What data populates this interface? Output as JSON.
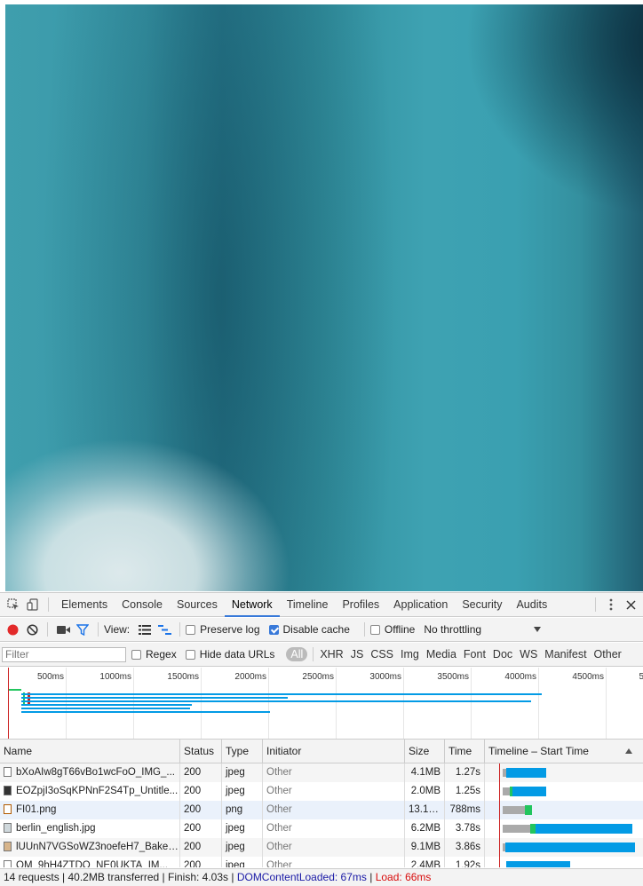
{
  "tabs": [
    "Elements",
    "Console",
    "Sources",
    "Network",
    "Timeline",
    "Profiles",
    "Application",
    "Security",
    "Audits"
  ],
  "active_tab": "Network",
  "toolbar": {
    "view_label": "View:",
    "preserve_log": "Preserve log",
    "disable_cache": "Disable cache",
    "offline": "Offline",
    "throttling": "No throttling",
    "record_color": "#e22929"
  },
  "filter": {
    "placeholder": "Filter",
    "regex": "Regex",
    "hide_data_urls": "Hide data URLs",
    "types": [
      "All",
      "XHR",
      "JS",
      "CSS",
      "Img",
      "Media",
      "Font",
      "Doc",
      "WS",
      "Manifest",
      "Other"
    ],
    "selected_type": "All"
  },
  "overview": {
    "ticks": [
      "500ms",
      "1000ms",
      "1500ms",
      "2000ms",
      "2500ms",
      "3000ms",
      "3500ms",
      "4000ms",
      "4500ms",
      "5"
    ]
  },
  "columns": {
    "name": "Name",
    "status": "Status",
    "type": "Type",
    "initiator": "Initiator",
    "size": "Size",
    "time": "Time",
    "timeline": "Timeline – Start Time"
  },
  "requests": [
    {
      "name": "bXoAIw8gT66vBo1wcFoO_IMG_...",
      "status": "200",
      "type": "jpeg",
      "initiator": "Other",
      "size": "4.1MB",
      "time": "1.27s"
    },
    {
      "name": "EOZpjI3oSqKPNnF2S4Tp_Untitle...",
      "status": "200",
      "type": "jpeg",
      "initiator": "Other",
      "size": "2.0MB",
      "time": "1.25s"
    },
    {
      "name": "FI01.png",
      "status": "200",
      "type": "png",
      "initiator": "Other",
      "size": "13.1KB",
      "time": "788ms"
    },
    {
      "name": "berlin_english.jpg",
      "status": "200",
      "type": "jpeg",
      "initiator": "Other",
      "size": "6.2MB",
      "time": "3.78s"
    },
    {
      "name": "lUUnN7VGSoWZ3noefeH7_Baker...",
      "status": "200",
      "type": "jpeg",
      "initiator": "Other",
      "size": "9.1MB",
      "time": "3.86s"
    },
    {
      "name": "OM_9hH4ZTDO_NE0UKTA_IM...",
      "status": "200",
      "type": "jpeg",
      "initiator": "Other",
      "size": "2.4MB",
      "time": "1.92s"
    }
  ],
  "status": {
    "summary": "14 requests | 40.2MB transferred | Finish: 4.03s | ",
    "dom_content_loaded": "DOMContentLoaded: 67ms",
    "divider": " | ",
    "load": "Load: 66ms",
    "dcl_color": "#1a1aa6",
    "load_color": "#d80c0c"
  }
}
